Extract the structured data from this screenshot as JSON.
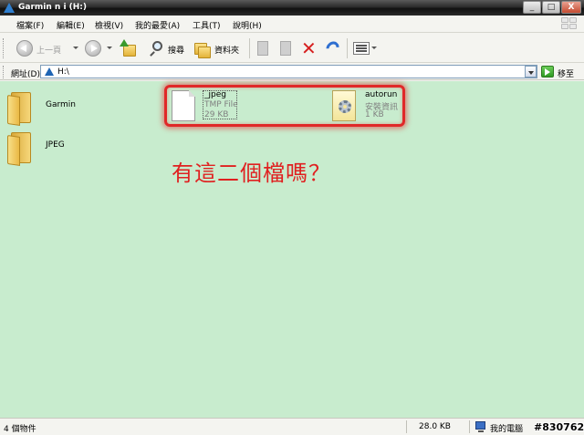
{
  "window": {
    "title": "Garmin n    i (H:)",
    "controls": {
      "minimize": "_",
      "maximize": "□",
      "close": "X"
    },
    "colors": {
      "content_background": "#c8ecce",
      "highlight": "#e02828",
      "annotation": "#e02020"
    }
  },
  "menu": {
    "items": [
      {
        "label": "檔案(F)"
      },
      {
        "label": "編輯(E)"
      },
      {
        "label": "檢視(V)"
      },
      {
        "label": "我的最愛(A)"
      },
      {
        "label": "工具(T)"
      },
      {
        "label": "說明(H)"
      }
    ],
    "logo": "windows-logo-icon"
  },
  "toolbar": {
    "back_label": "上一頁",
    "search_label": "搜尋",
    "folders_label": "資料夾"
  },
  "address": {
    "label": "網址(D)",
    "value": "H:\\",
    "go_label": "移至"
  },
  "files": [
    {
      "name": "Garmin",
      "type": "folder"
    },
    {
      "name": "JPEG",
      "type": "folder"
    },
    {
      "name": "_jpeg",
      "kind": "TMP File",
      "size": "29 KB"
    },
    {
      "name": "autorun",
      "kind": "安裝資訊",
      "size": "1 KB"
    }
  ],
  "annotation": "有這二個檔嗎？",
  "status": {
    "count": "4 個物件",
    "size": "28.0 KB",
    "location": "我的電腦",
    "watermark": "#830762"
  }
}
